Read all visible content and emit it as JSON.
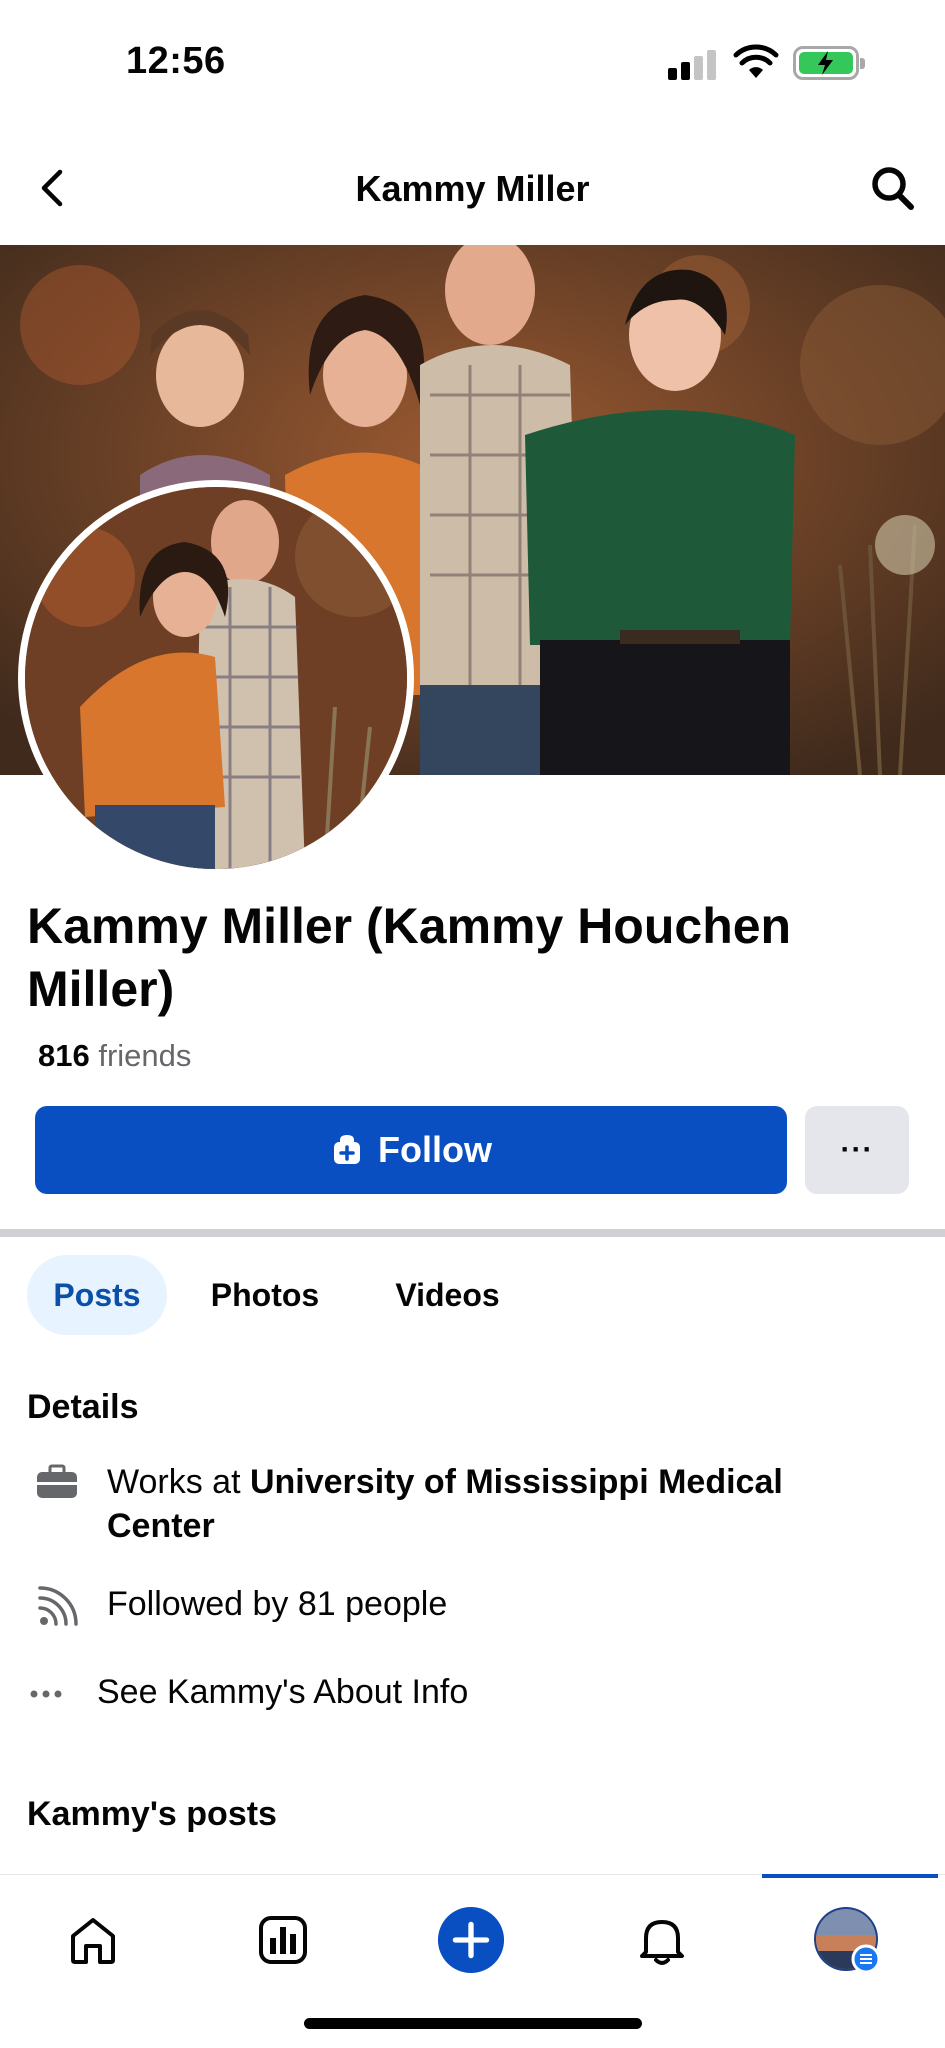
{
  "status_bar": {
    "time": "12:56"
  },
  "header": {
    "title": "Kammy Miller"
  },
  "profile": {
    "name": "Kammy Miller (Kammy Houchen Miller)",
    "friends_count": "816",
    "friends_label": "friends",
    "follow_label": "Follow",
    "more_label": "···"
  },
  "tabs": [
    {
      "label": "Posts",
      "active": true
    },
    {
      "label": "Photos",
      "active": false
    },
    {
      "label": "Videos",
      "active": false
    }
  ],
  "details": {
    "title": "Details",
    "works_prefix": "Works at ",
    "works_place": "University of Mississippi Medical Center",
    "followed_by": "Followed by 81 people",
    "about_link": "See Kammy's About Info"
  },
  "posts": {
    "title": "Kammy's posts"
  },
  "bottom_nav": {
    "items": [
      {
        "icon": "home-icon"
      },
      {
        "icon": "dashboard-icon"
      },
      {
        "icon": "create-plus-icon"
      },
      {
        "icon": "bell-icon"
      },
      {
        "icon": "profile-avatar-icon"
      }
    ]
  },
  "colors": {
    "primary": "#0a4fc2",
    "tab_active_bg": "#e7f3ff",
    "secondary_button": "#e4e6eb"
  }
}
